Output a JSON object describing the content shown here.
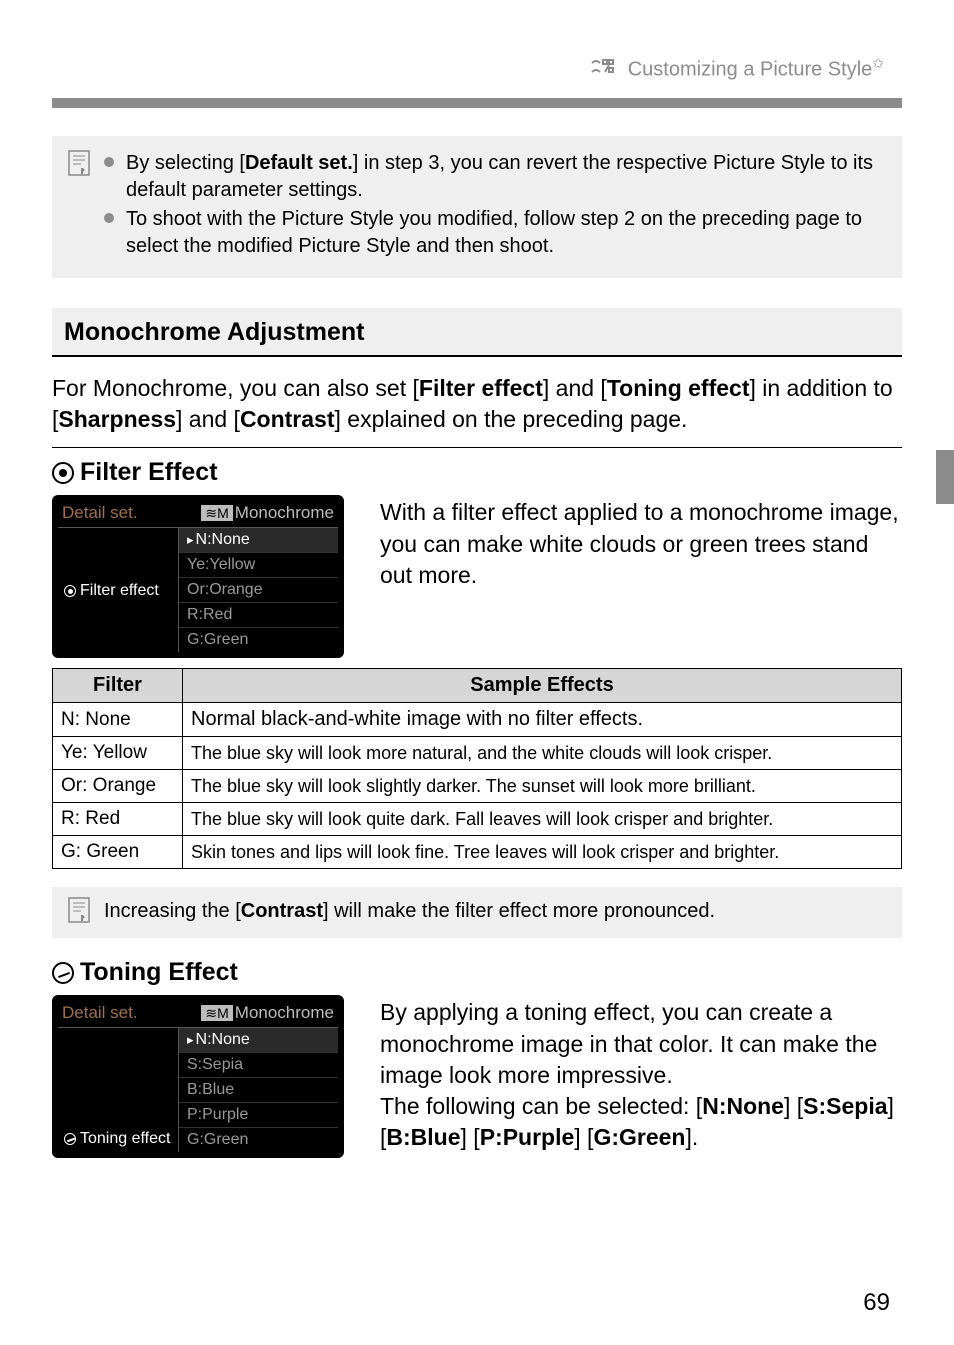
{
  "header": {
    "title": "Customizing a Picture Style"
  },
  "note1": {
    "items": [
      {
        "pre": "By selecting [",
        "bold": "Default set.",
        "post": "] in step 3, you can revert the respective Picture Style to its default parameter settings."
      },
      {
        "text": "To shoot with the Picture Style you modified, follow step 2 on the preceding page to select the modified Picture Style and then shoot."
      }
    ]
  },
  "section": {
    "heading": "Monochrome Adjustment",
    "para": {
      "p0": "For Monochrome, you can also set [",
      "b0": "Filter effect",
      "p1": "] and [",
      "b1": "Toning effect",
      "p2": "] in addition to [",
      "b2": "Sharpness",
      "p3": "] and [",
      "b3": "Contrast",
      "p4": "] explained on the preceding page."
    }
  },
  "filter": {
    "heading": "Filter Effect",
    "screen": {
      "title": "Detail set.",
      "mode": "Monochrome",
      "label": "Filter effect",
      "options": [
        "N:None",
        "Ye:Yellow",
        "Or:Orange",
        "R:Red",
        "G:Green"
      ]
    },
    "desc": "With a filter effect applied to a monochrome image, you can make white clouds or green trees stand out more.",
    "table": {
      "headers": [
        "Filter",
        "Sample Effects"
      ],
      "rows": [
        {
          "f": "N: None",
          "e": "Normal black-and-white image with no filter effects."
        },
        {
          "f": "Ye: Yellow",
          "e": "The blue sky will look more natural, and the white clouds will look crisper."
        },
        {
          "f": "Or: Orange",
          "e": "The blue sky will look slightly darker. The sunset will look more brilliant."
        },
        {
          "f": "R: Red",
          "e": "The blue sky will look quite dark. Fall leaves will look crisper and brighter."
        },
        {
          "f": "G: Green",
          "e": "Skin tones and lips will look fine. Tree leaves will look crisper and brighter."
        }
      ]
    },
    "note": {
      "pre": "Increasing the [",
      "bold": "Contrast",
      "post": "] will make the filter effect more pronounced."
    }
  },
  "toning": {
    "heading": "Toning Effect",
    "screen": {
      "title": "Detail set.",
      "mode": "Monochrome",
      "label": "Toning effect",
      "options": [
        "N:None",
        "S:Sepia",
        "B:Blue",
        "P:Purple",
        "G:Green"
      ]
    },
    "desc1": "By applying a toning effect, you can create a monochrome image in that color. It can make the image look more impressive.",
    "desc2": {
      "p0": "The following can be selected: [",
      "b0": "N:None",
      "p1": "] [",
      "b1": "S:Sepia",
      "p2": "] [",
      "b2": "B:Blue",
      "p3": "] [",
      "b3": "P:Purple",
      "p4": "] [",
      "b4": "G:Green",
      "p5": "]."
    }
  },
  "pagenum": "69"
}
